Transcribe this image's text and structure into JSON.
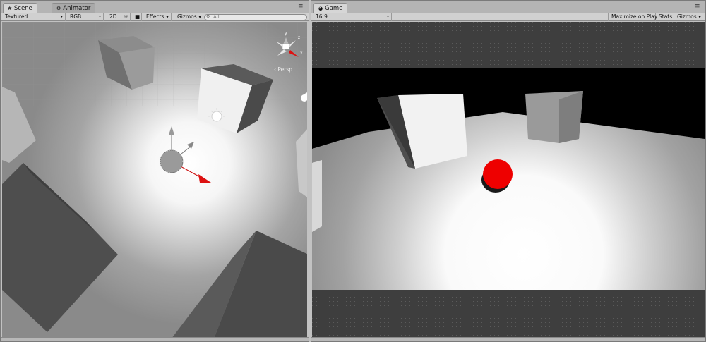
{
  "scene_panel": {
    "tabs": [
      {
        "label": "Scene",
        "icon": "scene-hash-icon",
        "active": true
      },
      {
        "label": "Animator",
        "icon": "animator-icon",
        "active": false
      }
    ],
    "toolbar": {
      "draw_mode": "Textured",
      "render_mode": "RGB",
      "mode_2d": "2D",
      "lighting_icon": "sun-icon",
      "effects": "Effects",
      "gizmos": "Gizmos",
      "search_prefix": "All"
    },
    "persp_label": "‹ Persp",
    "gizmo_axis_labels": {
      "y": "y",
      "z": "z",
      "x": "x"
    }
  },
  "game_panel": {
    "tabs": [
      {
        "label": "Game",
        "icon": "game-pacman-icon",
        "active": true
      }
    ],
    "toolbar": {
      "aspect": "16:9",
      "maximize": "Maximize on Play",
      "stats": "Stats",
      "gizmos": "Gizmos"
    }
  },
  "colors": {
    "panel_bg": "#c2c2c2",
    "sphere_red": "#ee0000",
    "axis_red": "#dd1111",
    "sky_black": "#000000"
  }
}
